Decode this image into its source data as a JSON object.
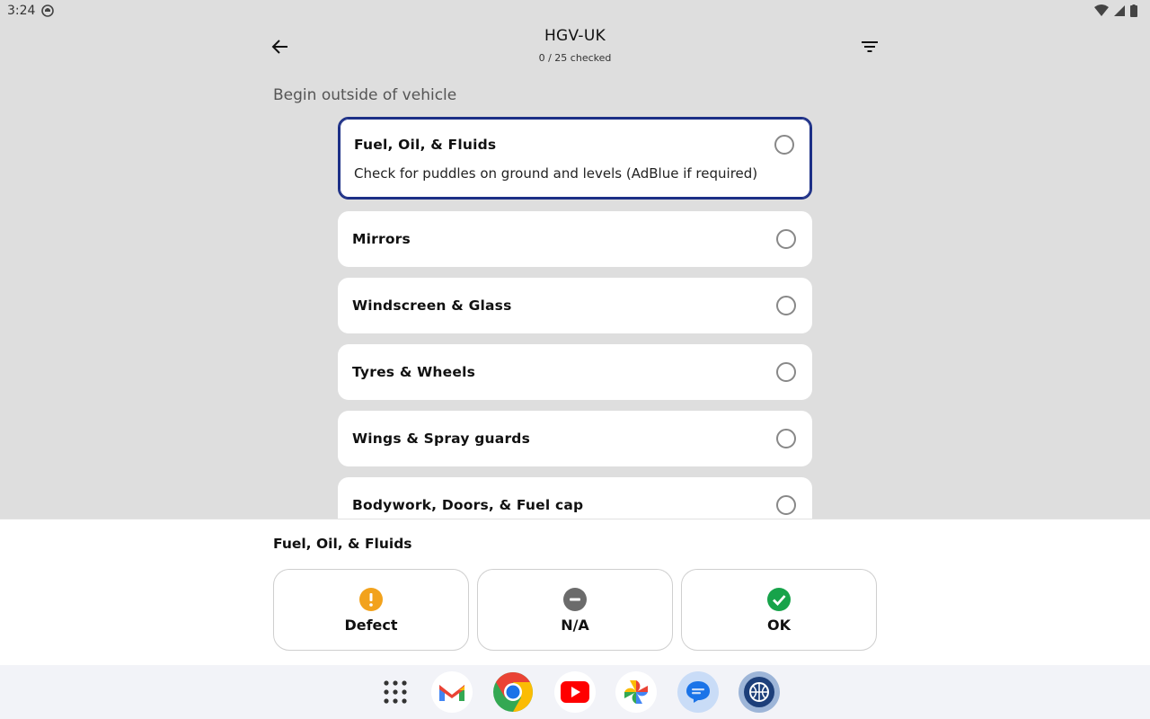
{
  "status_bar": {
    "time": "3:24"
  },
  "header": {
    "title": "HGV-UK",
    "progress": "0 / 25 checked"
  },
  "section": {
    "label": "Begin outside of vehicle"
  },
  "checklist": [
    {
      "name": "Fuel, Oil, & Fluids",
      "description": "Check for puddles on ground and levels (AdBlue if required)"
    },
    {
      "name": "Mirrors"
    },
    {
      "name": "Windscreen & Glass"
    },
    {
      "name": "Tyres & Wheels"
    },
    {
      "name": "Wings & Spray guards"
    },
    {
      "name": "Bodywork, Doors, & Fuel cap"
    }
  ],
  "panel": {
    "current_item": "Fuel, Oil, & Fluids",
    "actions": [
      {
        "label": "Defect",
        "icon": "warning-icon",
        "color": "#f2a21c"
      },
      {
        "label": "N/A",
        "icon": "minus-icon",
        "color": "#6b6b6b"
      },
      {
        "label": "OK",
        "icon": "check-icon",
        "color": "#17a34a"
      }
    ]
  },
  "dock": {
    "apps": [
      "app-drawer",
      "gmail",
      "chrome",
      "youtube",
      "photos",
      "messages",
      "checklist-app"
    ]
  },
  "colors": {
    "accent": "#1c2f86",
    "background": "#dedede"
  }
}
